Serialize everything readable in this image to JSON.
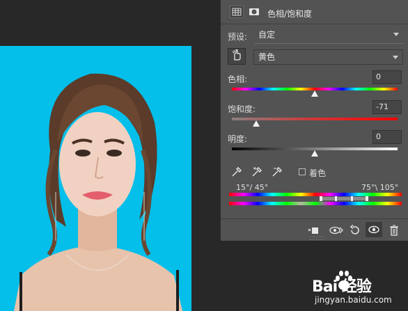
{
  "panel": {
    "title": "色相/饱和度",
    "preset_label": "预设:",
    "preset_value": "自定",
    "channel_value": "黄色",
    "hue_label": "色相:",
    "hue_value": "0",
    "sat_label": "饱和度:",
    "sat_value": "-71",
    "light_label": "明度:",
    "light_value": "0",
    "colorize_label": "着色",
    "range_left": "15°/ 45°",
    "range_right": "75°\\ 105°"
  },
  "sliders": {
    "hue": {
      "min": -180,
      "max": 180,
      "value": 0
    },
    "saturation": {
      "min": -100,
      "max": 100,
      "value": -71
    },
    "lightness": {
      "min": -100,
      "max": 100,
      "value": 0
    }
  },
  "watermark": {
    "logo_text": "Bai 经验",
    "url": "jingyan.baidu.com"
  },
  "colors": {
    "canvas_bg": "#04bfe9",
    "panel_bg": "#535353",
    "app_bg": "#282828"
  },
  "icons": [
    "adjustment-grid-icon",
    "mask-icon",
    "hand-targeted-adjust-icon",
    "eyedropper-icon",
    "eyedropper-add-icon",
    "eyedropper-subtract-icon",
    "clip-to-layer-icon",
    "view-previous-state-icon",
    "reset-icon",
    "visibility-eye-icon",
    "trash-icon"
  ]
}
